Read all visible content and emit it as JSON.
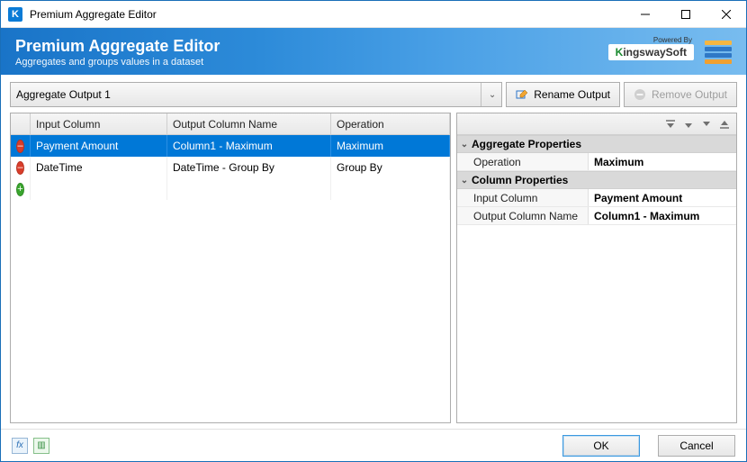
{
  "titlebar": {
    "title": "Premium Aggregate Editor"
  },
  "banner": {
    "title": "Premium Aggregate Editor",
    "subtitle": "Aggregates and groups values in a dataset",
    "powered_by": "Powered By",
    "brand_prefix": "K",
    "brand_rest": "ingswaySoft"
  },
  "toolbar": {
    "output_selected": "Aggregate Output 1",
    "rename_label": "Rename Output",
    "remove_label": "Remove Output"
  },
  "grid": {
    "headers": {
      "input": "Input Column",
      "output": "Output Column Name",
      "operation": "Operation"
    },
    "rows": [
      {
        "input": "Payment Amount",
        "output": "Column1 - Maximum",
        "operation": "Maximum",
        "selected": true
      },
      {
        "input": "DateTime",
        "output": "DateTime - Group By",
        "operation": "Group By",
        "selected": false
      }
    ]
  },
  "properties": {
    "cat_aggregate": "Aggregate Properties",
    "cat_column": "Column Properties",
    "rows": {
      "operation_key": "Operation",
      "operation_val": "Maximum",
      "input_key": "Input Column",
      "input_val": "Payment Amount",
      "output_key": "Output Column Name",
      "output_val": "Column1 - Maximum"
    }
  },
  "footer": {
    "ok": "OK",
    "cancel": "Cancel"
  }
}
